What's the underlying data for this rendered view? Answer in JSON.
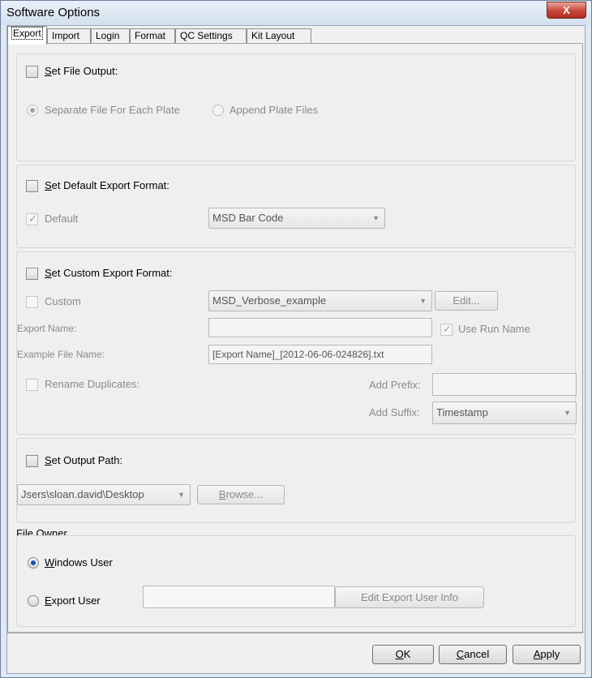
{
  "window": {
    "title": "Software Options",
    "close_glyph": "X"
  },
  "tabs": [
    "Export",
    "Import",
    "Login",
    "Format",
    "QC Settings",
    "Kit Layout"
  ],
  "file_output": {
    "title_u": "S",
    "title_rest": "et File Output:",
    "option1": "Separate File For Each Plate",
    "option2": "Append Plate Files"
  },
  "default_format": {
    "title_u": "S",
    "title_rest": "et Default Export Format:",
    "default_label": "Default",
    "format_value": "MSD Bar Code"
  },
  "custom_format": {
    "title_u": "S",
    "title_rest": "et Custom Export Format:",
    "custom_label": "Custom",
    "custom_value": "MSD_Verbose_example",
    "edit_label": "Edit...",
    "export_name_label": "Export Name:",
    "export_name_value": "",
    "use_run_name_label": "Use Run Name",
    "example_label": "Example File Name:",
    "example_value": "[Export Name]_[2012-06-06-024826].txt",
    "rename_label": "Rename Duplicates:",
    "prefix_label": "Add Prefix:",
    "prefix_value": "",
    "suffix_label": "Add Suffix:",
    "suffix_value": "Timestamp"
  },
  "output_path": {
    "title_u": "S",
    "title_rest": "et Output Path:",
    "path_value": "Jsers\\sloan.david\\Desktop",
    "browse_u": "B",
    "browse_rest": "rowse..."
  },
  "file_owner": {
    "legend": "File Owner",
    "windows_u": "W",
    "windows_rest": "indows User",
    "export_u": "E",
    "export_rest": "xport User",
    "export_user_value": "",
    "edit_info_label": "Edit Export User Info"
  },
  "footer": {
    "ok_u": "O",
    "ok_rest": "K",
    "cancel_u": "C",
    "cancel_rest": "ancel",
    "apply_u": "A",
    "apply_rest": "pply"
  }
}
